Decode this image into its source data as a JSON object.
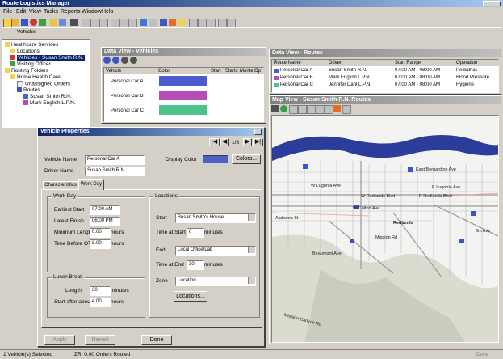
{
  "app": {
    "title": "Route Logistics Manager"
  },
  "menu": [
    "File",
    "Edit",
    "View",
    "Tasks",
    "Reports",
    "Window",
    "Help"
  ],
  "toolbar2_label": "Vehicles",
  "tree": [
    {
      "label": "Healthcare Services",
      "indent": 0
    },
    {
      "label": "Locations",
      "indent": 1
    },
    {
      "label": "Vehicles - Susan Smith R.N.",
      "indent": 1
    },
    {
      "label": "Visiting Officer",
      "indent": 1
    },
    {
      "label": "Routing Folders",
      "indent": 0
    },
    {
      "label": "Home Health Care",
      "indent": 1
    },
    {
      "label": "Unassigned Orders",
      "indent": 2
    },
    {
      "label": "Routes",
      "indent": 2
    },
    {
      "label": "Susan Smith R.N.",
      "indent": 3
    },
    {
      "label": "Mark English L.P.N.",
      "indent": 3
    }
  ],
  "vehicles_window": {
    "title": "Data View - Vehicles",
    "columns": [
      "Vehicle",
      "Color",
      "Start",
      "Starts",
      "Monte",
      "Op"
    ],
    "rows": [
      {
        "name": "Personal Car A",
        "color": "#4a5bd0"
      },
      {
        "name": "Personal Car B",
        "color": "#b34fb8"
      },
      {
        "name": "Personal Car C",
        "color": "#4cc38a"
      }
    ]
  },
  "orders_window": {
    "title": "Data View - Routes",
    "columns": [
      "Route Name",
      "Driver",
      "Start Range",
      "Operation"
    ],
    "rows": [
      {
        "route": "Personal Car A",
        "driver": "Susan Smith R.N.",
        "range": "07:00 AM - 08:00 AM",
        "op": "Pediatrics"
      },
      {
        "route": "Personal Car B",
        "driver": "Mark English L.P.N.",
        "range": "07:00 AM - 08:00 AM",
        "op": "Blood Pressure"
      },
      {
        "route": "Personal Car C",
        "driver": "Jennifer Dahl L.P.N.",
        "range": "07:00 AM - 08:00 AM",
        "op": "Hygiene"
      }
    ]
  },
  "map_window": {
    "title": "Map View - Susan Smith R.N. Routes",
    "labels": [
      {
        "text": "East Bernardino Ave"
      },
      {
        "text": "E Lugonia Ave"
      },
      {
        "text": "W Lugonia Ave"
      },
      {
        "text": "W Redlands Blvd"
      },
      {
        "text": "E Redlands Blvd"
      },
      {
        "text": "W Colton Ave"
      },
      {
        "text": "Alabama St"
      },
      {
        "text": "Mission Rd"
      },
      {
        "text": "Beaumont Ave"
      },
      {
        "text": "9th Ave"
      },
      {
        "text": "Mission Canyon Rd"
      },
      {
        "text": "Redlands"
      }
    ]
  },
  "dialog": {
    "title": "Vehicle Properties",
    "nav_label": "1/3",
    "vehicle_name_label": "Vehicle Name",
    "vehicle_name": "Personal Car A",
    "driver_name_label": "Driver Name",
    "driver_name": "Susan Smith R.N.",
    "display_color_label": "Display Color",
    "display_color": "#4a62c8",
    "colors_button": "Colors...",
    "tabs": [
      "Characteristics",
      "Work Day"
    ],
    "workday_group": "Work Day",
    "earliest_start_label": "Earliest Start",
    "earliest_start": "07:00 AM",
    "latest_finish_label": "Latest Finish",
    "latest_finish": "06:00 PM",
    "min_length_label": "Minimum Length",
    "min_length": "0.00",
    "time_before_ot_label": "Time Before OT",
    "time_before_ot": "8.00",
    "hours_unit": "hours",
    "lunch_group": "Lunch Break",
    "length_label": "Length",
    "length": "30",
    "minutes_unit": "minutes",
    "start_after_label": "Start after about",
    "start_after": "4.00",
    "locations_group": "Locations",
    "start_label": "Start",
    "start_value": "Susan Smith's House",
    "time_at_start_label": "Time at Start",
    "time_at_start": "0",
    "end_label": "End",
    "end_value": "Local Office/Lab",
    "time_at_end_label": "Time at End",
    "time_at_end": "30",
    "zone_label": "Zone",
    "zone_value": "Location",
    "locations_button": "Locations...",
    "apply_button": "Apply",
    "revert_button": "Revert",
    "done_button": "Done"
  },
  "status": {
    "left": "1 Vehicle(s) Selected",
    "middle": "ZR: 0.00 Orders Routed",
    "right": "Done"
  }
}
